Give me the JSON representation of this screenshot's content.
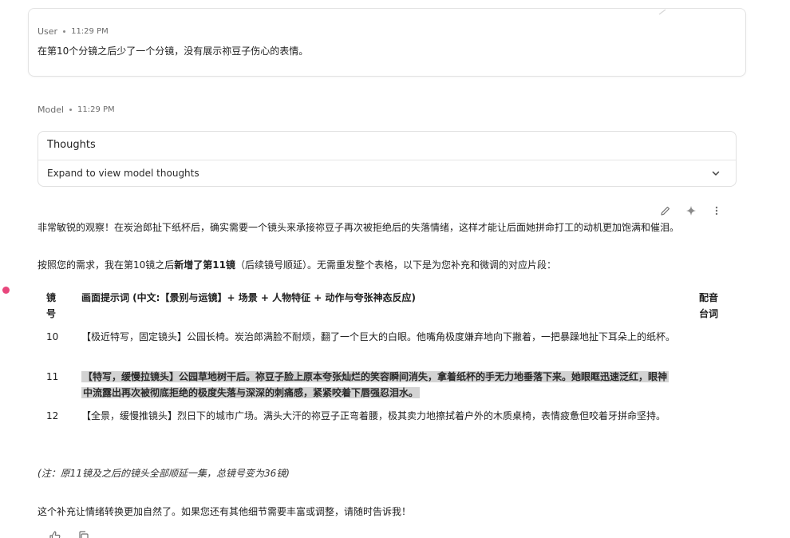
{
  "user_message": {
    "role": "User",
    "time": "11:29 PM",
    "text": "在第10个分镜之后少了一个分镜，没有展示祢豆子伤心的表情。"
  },
  "model_message": {
    "role": "Model",
    "time": "11:29 PM",
    "thoughts": {
      "title": "Thoughts",
      "expand_label": "Expand to view model thoughts"
    },
    "paragraph1": "非常敏锐的观察！在炭治郎扯下纸杯后，确实需要一个镜头来承接祢豆子再次被拒绝后的失落情绪，这样才能让后面她拼命打工的动机更加饱满和催泪。",
    "paragraph2": {
      "before": "按照您的需求，我在第10镜之后",
      "bold": "新增了第11镜",
      "after": "（后续镜号顺延）。无需重发整个表格，以下是为您补充和微调的对应片段："
    },
    "table": {
      "headers": {
        "num": "镜号",
        "prompt": "画面提示词 (中文:【景别与运镜】+ 场景 + 人物特征 + 动作与夸张神态反应)",
        "dub": "配音台词"
      },
      "rows": [
        {
          "num": "10",
          "prompt": "【极近特写，固定镜头】公园长椅。炭治郎满脸不耐烦，翻了一个巨大的白眼。他嘴角极度嫌弃地向下撇着，一把暴躁地扯下耳朵上的纸杯。",
          "dub": ""
        },
        {
          "num": "11",
          "prompt": "【特写，缓慢拉镜头】公园草地树干后。祢豆子脸上原本夸张灿烂的笑容瞬间消失，拿着纸杯的手无力地垂落下来。她眼眶迅速泛红，眼神中流露出再次被彻底拒绝的极度失落与深深的刺痛感，紧紧咬着下唇强忍泪水。",
          "dub": "",
          "highlighted": true
        },
        {
          "num": "12",
          "prompt": "【全景，缓慢推镜头】烈日下的城市广场。满头大汗的祢豆子正弯着腰，极其卖力地擦拭着户外的木质桌椅，表情疲惫但咬着牙拼命坚持。",
          "dub": ""
        }
      ]
    },
    "note": "(注：原11镜及之后的镜头全部顺延一集，总镜号变为36镜)",
    "closing": "这个补充让情绪转换更加自然了。如果您还有其他细节需要丰富或调整，请随时告诉我！"
  },
  "icons": {
    "edit": "pencil-icon",
    "sparkle": "sparkle-icon",
    "more": "more-vert-icon",
    "expand": "chevron-down-icon",
    "thumb_up": "thumb-up-icon",
    "copy": "copy-icon"
  },
  "colors": {
    "highlight": "#d3d3d3",
    "marker": "#e8467c"
  }
}
